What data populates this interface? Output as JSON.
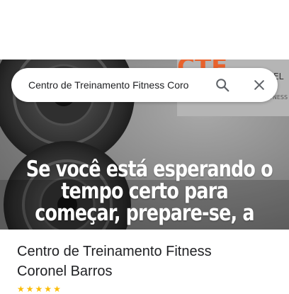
{
  "search": {
    "value": "Centro de Treinamento Fitness Coro"
  },
  "photo": {
    "overlay_lines": [
      "Se você está esperando o",
      "tempo certo para",
      "começar, prepare-se, a"
    ],
    "logo_partial": "CTF",
    "sign_partial": "EL",
    "sign_small": "TNESS"
  },
  "place": {
    "title_line1": "Centro de Treinamento Fitness",
    "title_line2": "Coronel Barros"
  },
  "icons": {
    "search": "search-icon",
    "close": "close-icon"
  },
  "colors": {
    "accent_orange": "#e8622c",
    "text_primary": "#202124",
    "icon_gray": "#5f6368",
    "star": "#fbbc04"
  }
}
